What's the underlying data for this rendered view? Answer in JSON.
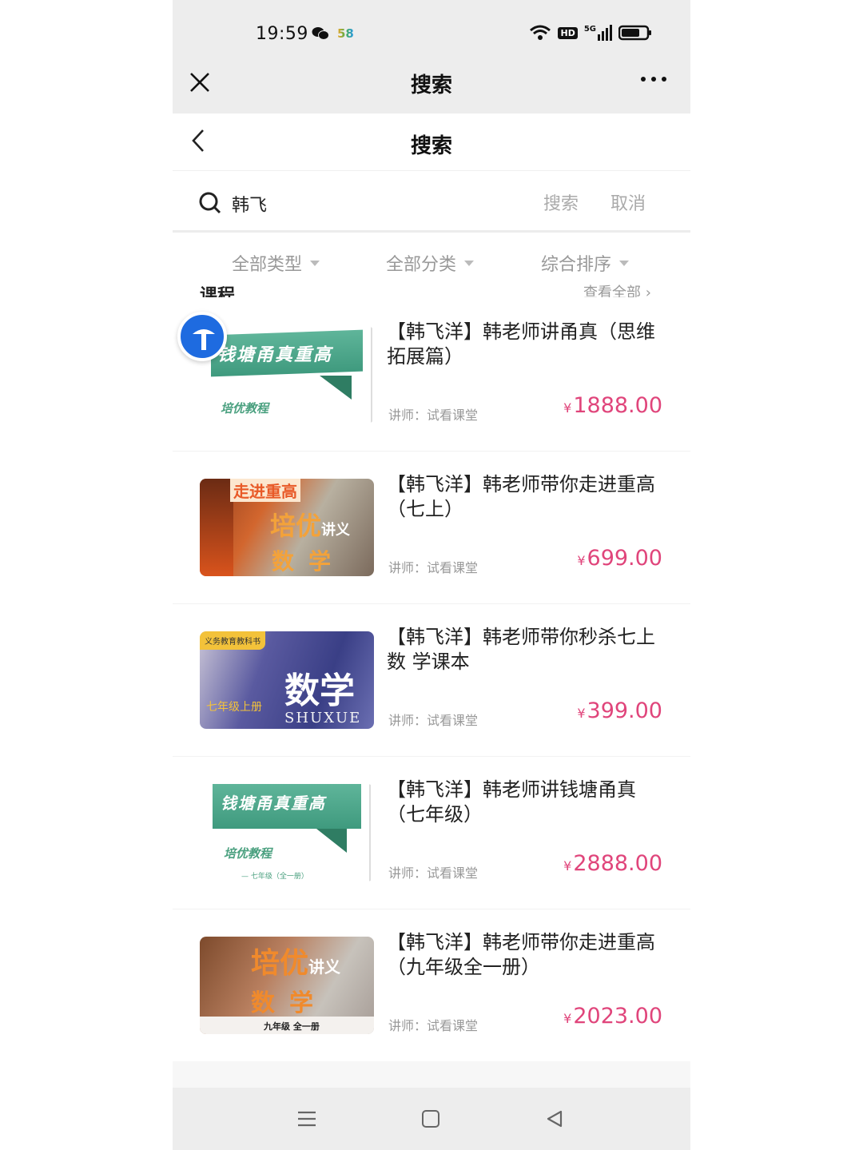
{
  "status_bar": {
    "time": "19:59",
    "app_badge": "58",
    "hd_label": "HD",
    "network_label": "5G"
  },
  "wechat_bar": {
    "title": "搜索"
  },
  "page_header": {
    "title": "搜索"
  },
  "search": {
    "value": "韩飞",
    "search_label": "搜索",
    "cancel_label": "取消"
  },
  "filters": [
    {
      "label": "全部类型"
    },
    {
      "label": "全部分类"
    },
    {
      "label": "综合排序"
    }
  ],
  "partial_section": {
    "left": "课程",
    "right": "查看全部 ›"
  },
  "courses": [
    {
      "title": "【韩飞洋】韩老师讲甬真（思维拓展篇）",
      "teacher": "讲师：试看课堂",
      "currency": "¥",
      "price": "1888.00",
      "thumb": {
        "line1": "钱塘甬真重高",
        "line2": "培优教程"
      }
    },
    {
      "title": "【韩飞洋】韩老师带你走进重高（七上）",
      "teacher": "讲师：试看课堂",
      "currency": "¥",
      "price": "699.00",
      "thumb": {
        "line1": "走进重高",
        "line2": "培优",
        "line2_small": "讲义",
        "line3": "数学"
      }
    },
    {
      "title": "【韩飞洋】韩老师带你秒杀七上数 学课本",
      "teacher": "讲师：试看课堂",
      "currency": "¥",
      "price": "399.00",
      "thumb": {
        "tag": "义务教育教科书",
        "big": "数学",
        "left": "七年级上册",
        "en": "SHUXUE"
      }
    },
    {
      "title": "【韩飞洋】韩老师讲钱塘甬真（七年级）",
      "teacher": "讲师：试看课堂",
      "currency": "¥",
      "price": "2888.00",
      "thumb": {
        "line1": "钱塘甬真重高",
        "line2": "培优教程",
        "grade": "— 七年级（全一册）"
      }
    },
    {
      "title": "【韩飞洋】韩老师带你走进重高（九年级全一册）",
      "teacher": "讲师：试看课堂",
      "currency": "¥",
      "price": "2023.00",
      "thumb": {
        "line2": "培优",
        "line2_small": "讲义",
        "line3": "数学",
        "grade": "九年级 全一册"
      }
    }
  ],
  "colors": {
    "price": "#e0457b",
    "float_button": "#1e6be0",
    "muted": "#999999"
  }
}
